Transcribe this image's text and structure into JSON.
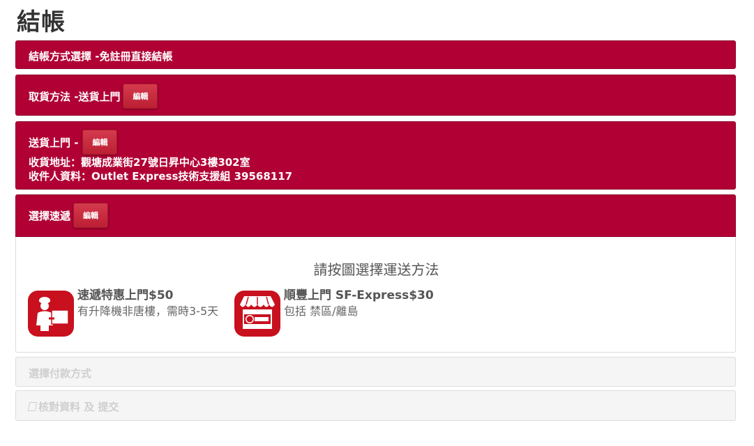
{
  "page": {
    "title": "結帳"
  },
  "step1": {
    "label": "結帳方式選擇 -免註冊直接結帳"
  },
  "step2": {
    "label": "取貨方法 -送貨上門",
    "edit_label": "編輯"
  },
  "step3": {
    "label": "送貨上門 -",
    "edit_label": "編輯",
    "address_line": "收貨地址：觀塘成業街27號日昇中心3樓302室",
    "recipient_line": "收件人資料：Outlet Express技術支援組 39568117"
  },
  "step4": {
    "label": "選擇速遞",
    "edit_label": "編輯",
    "prompt": "請按圖選擇運送方法",
    "options": [
      {
        "title": "速遞特惠上門$50",
        "desc": "有升降機非唐樓，需時3-5天",
        "icon": "courier-delivery-icon"
      },
      {
        "title": "順豐上門 SF-Express$30",
        "desc": "包括 禁區/離島",
        "icon": "sf-express-store-icon"
      }
    ]
  },
  "step5": {
    "label": "選擇付款方式"
  },
  "step6": {
    "label": "核對資料 及 提交"
  },
  "colors": {
    "accent": "#b10034",
    "icon_bg": "#c8101e",
    "disabled_bg": "#f5f5f5"
  }
}
